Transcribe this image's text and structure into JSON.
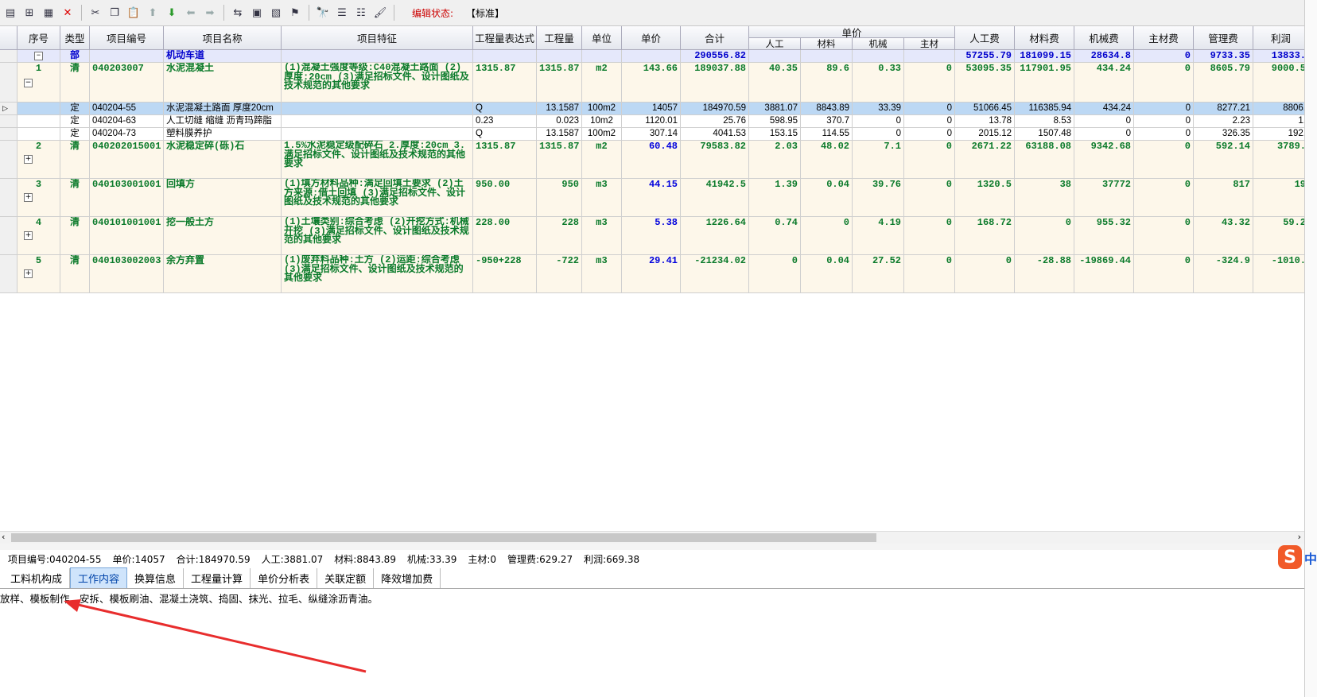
{
  "toolbar": {
    "edit_label": "编辑状态:",
    "edit_value": "【标准】"
  },
  "headers": {
    "seq": "序号",
    "type": "类型",
    "code": "项目编号",
    "name": "项目名称",
    "feature": "项目特征",
    "expr": "工程量表达式",
    "qty": "工程量",
    "unit": "单位",
    "price": "单价",
    "total": "合计",
    "unit_price_group": "单价",
    "labor": "人工",
    "material": "材料",
    "machine": "机械",
    "main_mat": "主材",
    "labor_fee": "人工费",
    "material_fee": "材料费",
    "machine_fee": "机械费",
    "main_mat_fee": "主材费",
    "mgmt_fee": "管理费",
    "profit": "利润"
  },
  "section": {
    "type": "部",
    "name": "机动车道",
    "total": "290556.82",
    "labor_fee": "57255.79",
    "material_fee": "181099.15",
    "machine_fee": "28634.8",
    "main_mat_fee": "0",
    "mgmt_fee": "9733.35",
    "profit": "13833."
  },
  "rows": [
    {
      "seq": "1",
      "type": "清",
      "code": "040203007",
      "name": "水泥混凝土",
      "feature": "(1)混凝土强度等级:C40混凝土路面 (2)厚度:20cm (3)满足招标文件、设计图纸及技术规范的其他要求",
      "expr": "1315.87",
      "qty": "1315.87",
      "unit": "m2",
      "price": "143.66",
      "total": "189037.88",
      "labor": "40.35",
      "material": "89.6",
      "machine": "0.33",
      "main_mat": "0",
      "labor_fee": "53095.35",
      "material_fee": "117901.95",
      "machine_fee": "434.24",
      "main_mat_fee": "0",
      "mgmt_fee": "8605.79",
      "profit": "9000.5"
    },
    {
      "seq": "",
      "type": "定",
      "code": "040204-55",
      "name": "水泥混凝土路面 厚度20cm",
      "feature": "",
      "expr": "Q",
      "qty": "13.1587",
      "unit": "100m2",
      "price": "14057",
      "total": "184970.59",
      "labor": "3881.07",
      "material": "8843.89",
      "machine": "33.39",
      "main_mat": "0",
      "labor_fee": "51066.45",
      "material_fee": "116385.94",
      "machine_fee": "434.24",
      "main_mat_fee": "0",
      "mgmt_fee": "8277.21",
      "profit": "8806."
    },
    {
      "seq": "",
      "type": "定",
      "code": "040204-63",
      "name": "人工切缝 缩缝 沥青玛蹄脂",
      "feature": "",
      "expr": "0.23",
      "qty": "0.023",
      "unit": "10m2",
      "price": "1120.01",
      "total": "25.76",
      "labor": "598.95",
      "material": "370.7",
      "machine": "0",
      "main_mat": "0",
      "labor_fee": "13.78",
      "material_fee": "8.53",
      "machine_fee": "0",
      "main_mat_fee": "0",
      "mgmt_fee": "2.23",
      "profit": "1."
    },
    {
      "seq": "",
      "type": "定",
      "code": "040204-73",
      "name": "塑料膜养护",
      "feature": "",
      "expr": "Q",
      "qty": "13.1587",
      "unit": "100m2",
      "price": "307.14",
      "total": "4041.53",
      "labor": "153.15",
      "material": "114.55",
      "machine": "0",
      "main_mat": "0",
      "labor_fee": "2015.12",
      "material_fee": "1507.48",
      "machine_fee": "0",
      "main_mat_fee": "0",
      "mgmt_fee": "326.35",
      "profit": "192."
    },
    {
      "seq": "2",
      "type": "清",
      "code": "040202015001",
      "name": "水泥稳定碎(砾)石",
      "feature": "1.5%水泥稳定级配碎石 2.厚度:20cm 3.满足招标文件、设计图纸及技术规范的其他要求",
      "expr": "1315.87",
      "qty": "1315.87",
      "unit": "m2",
      "price": "60.48",
      "total": "79583.82",
      "labor": "2.03",
      "material": "48.02",
      "machine": "7.1",
      "main_mat": "0",
      "labor_fee": "2671.22",
      "material_fee": "63188.08",
      "machine_fee": "9342.68",
      "main_mat_fee": "0",
      "mgmt_fee": "592.14",
      "profit": "3789."
    },
    {
      "seq": "3",
      "type": "清",
      "code": "040103001001",
      "name": "回填方",
      "feature": "(1)填方材料品种:满足回填土要求 (2)土方来源:借土回填 (3)满足招标文件、设计图纸及技术规范的其他要求",
      "expr": "950.00",
      "qty": "950",
      "unit": "m3",
      "price": "44.15",
      "total": "41942.5",
      "labor": "1.39",
      "material": "0.04",
      "machine": "39.76",
      "main_mat": "0",
      "labor_fee": "1320.5",
      "material_fee": "38",
      "machine_fee": "37772",
      "main_mat_fee": "0",
      "mgmt_fee": "817",
      "profit": "19"
    },
    {
      "seq": "4",
      "type": "清",
      "code": "040101001001",
      "name": "挖一般土方",
      "feature": "(1)土壤类别:综合考虑 (2)开挖方式:机械开挖 (3)满足招标文件、设计图纸及技术规范的其他要求",
      "expr": "228.00",
      "qty": "228",
      "unit": "m3",
      "price": "5.38",
      "total": "1226.64",
      "labor": "0.74",
      "material": "0",
      "machine": "4.19",
      "main_mat": "0",
      "labor_fee": "168.72",
      "material_fee": "0",
      "machine_fee": "955.32",
      "main_mat_fee": "0",
      "mgmt_fee": "43.32",
      "profit": "59.2"
    },
    {
      "seq": "5",
      "type": "清",
      "code": "040103002003",
      "name": "余方弃置",
      "feature": "(1)废弃料品种:土方 (2)运距:综合考虑 (3)满足招标文件、设计图纸及技术规范的其他要求",
      "expr": "-950+228",
      "qty": "-722",
      "unit": "m3",
      "price": "29.41",
      "total": "-21234.02",
      "labor": "0",
      "material": "0.04",
      "machine": "27.52",
      "main_mat": "0",
      "labor_fee": "0",
      "material_fee": "-28.88",
      "machine_fee": "-19869.44",
      "main_mat_fee": "0",
      "mgmt_fee": "-324.9",
      "profit": "-1010."
    }
  ],
  "status": [
    "项目编号:040204-55",
    "单价:14057",
    "合计:184970.59",
    "人工:3881.07",
    "材料:8843.89",
    "机械:33.39",
    "主材:0",
    "管理费:629.27",
    "利润:669.38"
  ],
  "tabs": [
    "工料机构成",
    "工作内容",
    "换算信息",
    "工程量计算",
    "单价分析表",
    "关联定额",
    "降效增加费"
  ],
  "active_tab": "工作内容",
  "work_content": "放样、模板制作、安拆、模板刷油、混凝土浇筑、捣固、抹光、拉毛、纵缝涂沥青油。",
  "ime": {
    "badge": "S",
    "label": "中"
  }
}
